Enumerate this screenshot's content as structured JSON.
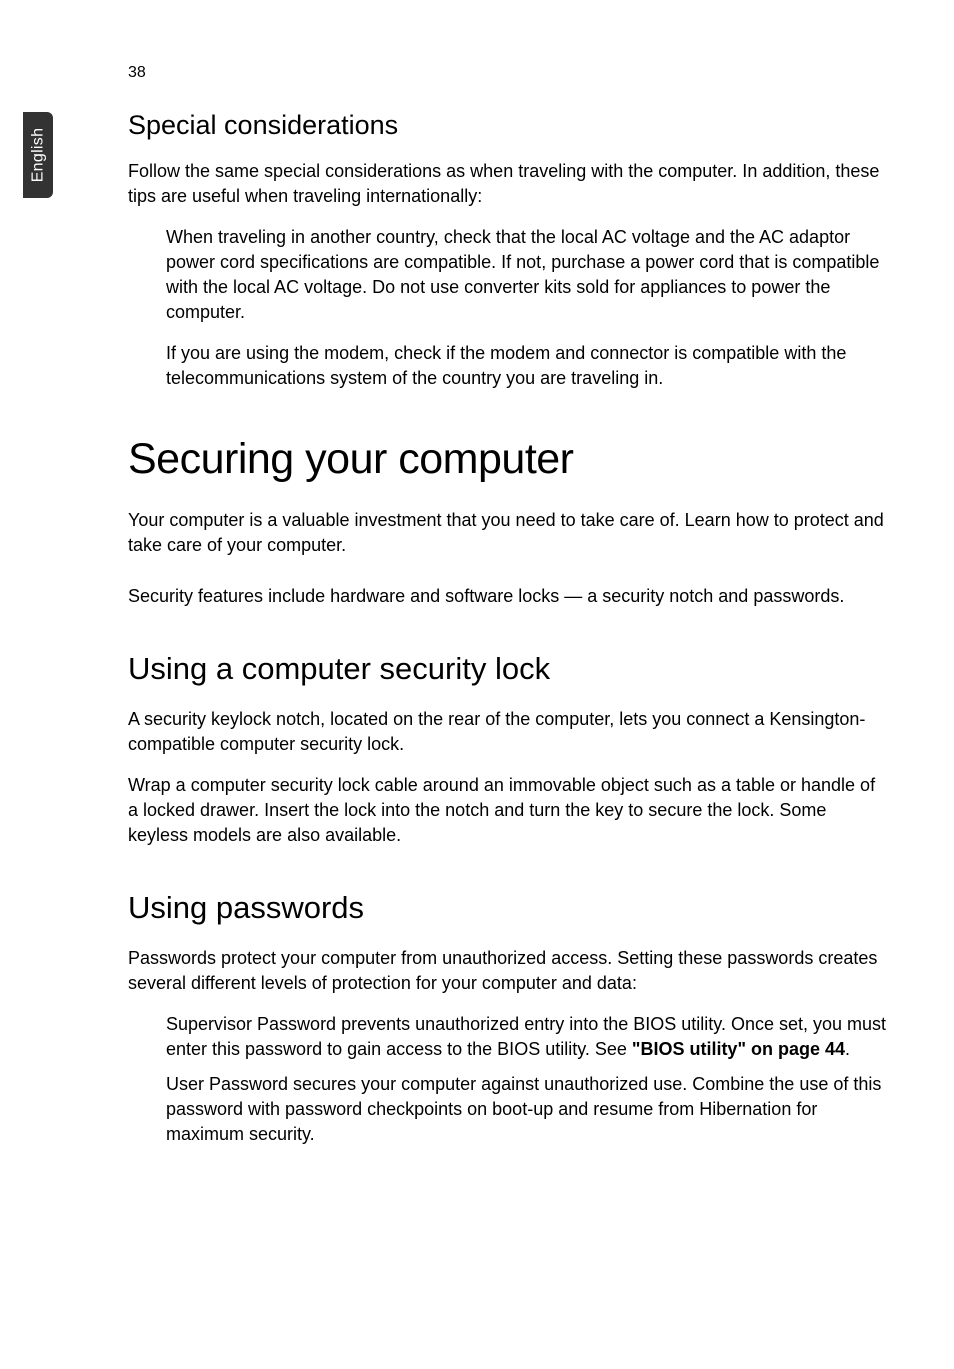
{
  "page_number": "38",
  "side_tab": "English",
  "sections": {
    "special": {
      "heading": "Special considerations",
      "intro": "Follow the same special considerations as when traveling with the computer. In addition, these tips are useful when traveling internationally:",
      "bullet1": "When traveling in another country, check that the local AC voltage and the AC adaptor power cord specifications are compatible. If not, purchase a power cord that is compatible with the local AC voltage. Do not use converter kits sold for appliances to power the computer.",
      "bullet2": "If you are using the modem, check if the modem and connector is compatible with the telecommunications system of the country you are traveling in."
    },
    "securing": {
      "heading": "Securing your computer",
      "p1": "Your computer is a valuable investment that you need to take care of. Learn how to protect and take care of your computer.",
      "p2": "Security features include hardware and software locks — a security notch and passwords."
    },
    "lock": {
      "heading": "Using a computer security lock",
      "p1": "A security keylock notch, located on the rear of the computer, lets you connect a Kensington-compatible computer security lock.",
      "p2": "Wrap a computer security lock cable around an immovable object such as a table or handle of a locked drawer. Insert the lock into the notch and turn the key to secure the lock. Some keyless models are also available."
    },
    "passwords": {
      "heading": "Using passwords",
      "intro": "Passwords protect your computer from unauthorized access. Setting these passwords creates several different levels of protection for your computer and data:",
      "bullet1_pre": "Supervisor Password prevents unauthorized entry into the BIOS utility. Once set, you must enter this password to gain access to the BIOS utility. See ",
      "bullet1_link": "\"BIOS utility\" on page 44",
      "bullet1_post": ".",
      "bullet2": "User Password secures your computer against unauthorized use. Combine the use of this password with password checkpoints on boot-up and resume from Hibernation for maximum security."
    }
  }
}
